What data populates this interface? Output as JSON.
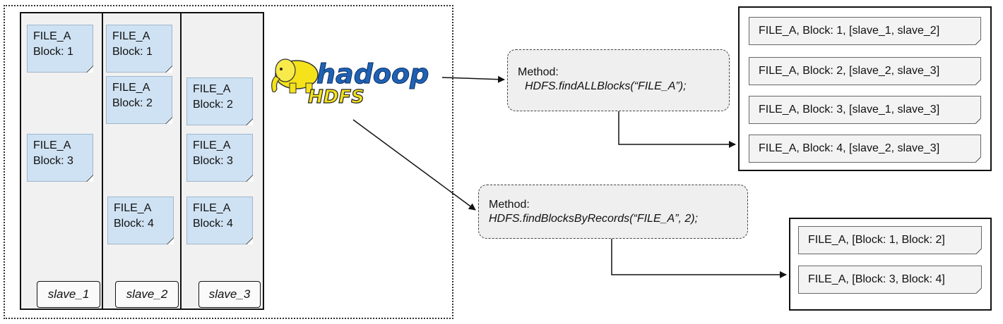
{
  "slaves": [
    {
      "label": "slave_1"
    },
    {
      "label": "slave_2"
    },
    {
      "label": "slave_3"
    }
  ],
  "blocks": [
    {
      "file": "FILE_A",
      "block": "Block: 1"
    },
    {
      "file": "FILE_A",
      "block": "Block: 3"
    },
    {
      "file": "FILE_A",
      "block": "Block: 1"
    },
    {
      "file": "FILE_A",
      "block": "Block: 2"
    },
    {
      "file": "FILE_A",
      "block": "Block: 4"
    },
    {
      "file": "FILE_A",
      "block": "Block: 2"
    },
    {
      "file": "FILE_A",
      "block": "Block: 3"
    },
    {
      "file": "FILE_A",
      "block": "Block: 4"
    }
  ],
  "logo": {
    "main": "hadoop",
    "sub": "HDFS"
  },
  "methods": [
    {
      "label": "Method:",
      "call": "HDFS.findALLBlocks(“FILE_A”);"
    },
    {
      "label": "Method:",
      "call": "HDFS.findBlocksByRecords(“FILE_A”, 2);"
    }
  ],
  "all_blocks_results": [
    "FILE_A, Block: 1, [slave_1, slave_2]",
    "FILE_A, Block: 2, [slave_2, slave_3]",
    "FILE_A, Block: 3, [slave_1, slave_3]",
    "FILE_A, Block: 4, [slave_2, slave_3]"
  ],
  "records_results": [
    "FILE_A, [Block: 1, Block: 2]",
    "FILE_A, [Block: 3, Block: 4]"
  ],
  "colors": {
    "note_fill": "#cfe2f3",
    "column_fill": "#f1f1f1",
    "method_fill": "#efefef",
    "logo_blue": "#1f62b4",
    "logo_yellow": "#f5e21b"
  }
}
